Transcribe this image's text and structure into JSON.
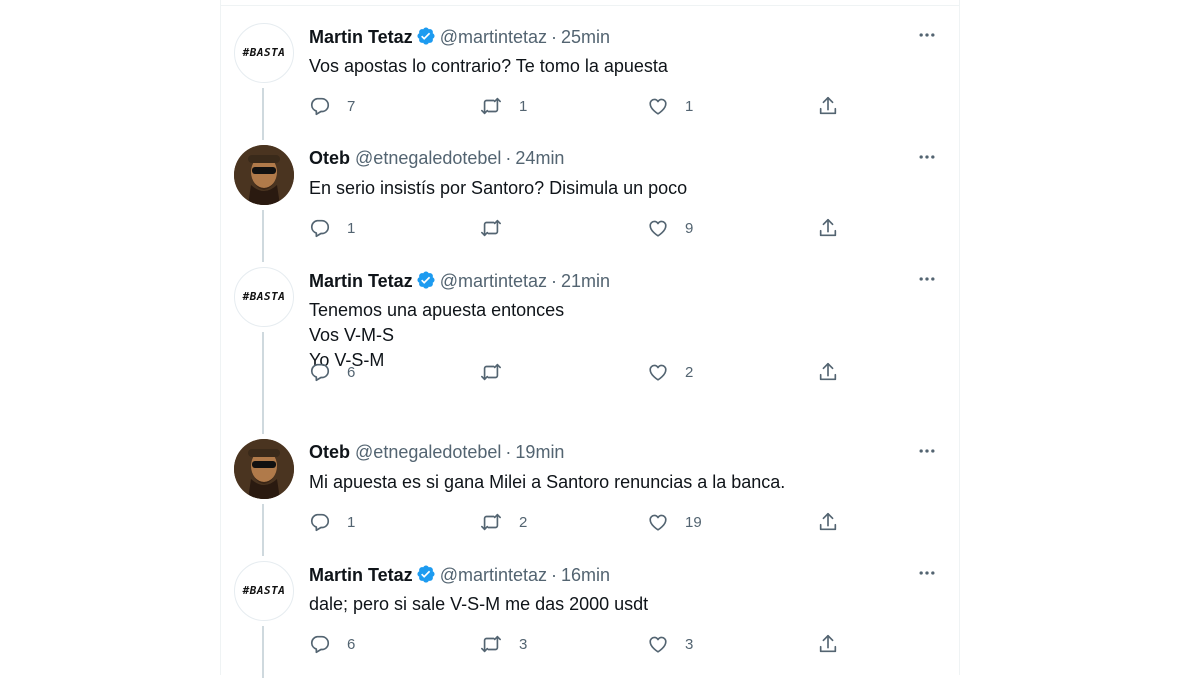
{
  "tweets": [
    {
      "name": "Martin Tetaz",
      "handle": "@martintetaz",
      "time": "25min",
      "avatar": "basta",
      "avatar_text": "#BASTA",
      "verified": true,
      "text": "Vos apostas lo contrario? Te tomo la apuesta",
      "replies": "7",
      "retweets": "1",
      "likes": "1"
    },
    {
      "name": "Oteb",
      "handle": "@etnegaledotebel",
      "time": "24min",
      "avatar": "oteb",
      "verified": false,
      "text": "En serio insistís por Santoro? Disimula un poco",
      "replies": "1",
      "retweets": "",
      "likes": "9"
    },
    {
      "name": "Martin Tetaz",
      "handle": "@martintetaz",
      "time": "21min",
      "avatar": "basta",
      "avatar_text": "#BASTA",
      "verified": true,
      "text": "Tenemos una apuesta entonces\nVos V-M-S\nYo V-S-M",
      "replies": "6",
      "retweets": "",
      "likes": "2"
    },
    {
      "name": "Oteb",
      "handle": "@etnegaledotebel",
      "time": "19min",
      "avatar": "oteb",
      "verified": false,
      "text": "Mi apuesta es si gana Milei a Santoro renuncias a la banca.",
      "replies": "1",
      "retweets": "2",
      "likes": "19"
    },
    {
      "name": "Martin Tetaz",
      "handle": "@martintetaz",
      "time": "16min",
      "avatar": "basta",
      "avatar_text": "#BASTA",
      "verified": true,
      "text": "dale; pero si sale V-S-M me das 2000 usdt",
      "replies": "6",
      "retweets": "3",
      "likes": "3"
    }
  ],
  "separator": "·",
  "icons": {
    "more": "more-dots-icon",
    "reply": "reply-icon",
    "retweet": "retweet-icon",
    "like": "like-icon",
    "share": "share-icon",
    "verified": "verified-badge-icon"
  },
  "colors": {
    "text": "#0f1419",
    "secondary": "#536471",
    "verified": "#1d9bf0",
    "thread_line": "#cfd9de",
    "border": "#eff3f4"
  }
}
